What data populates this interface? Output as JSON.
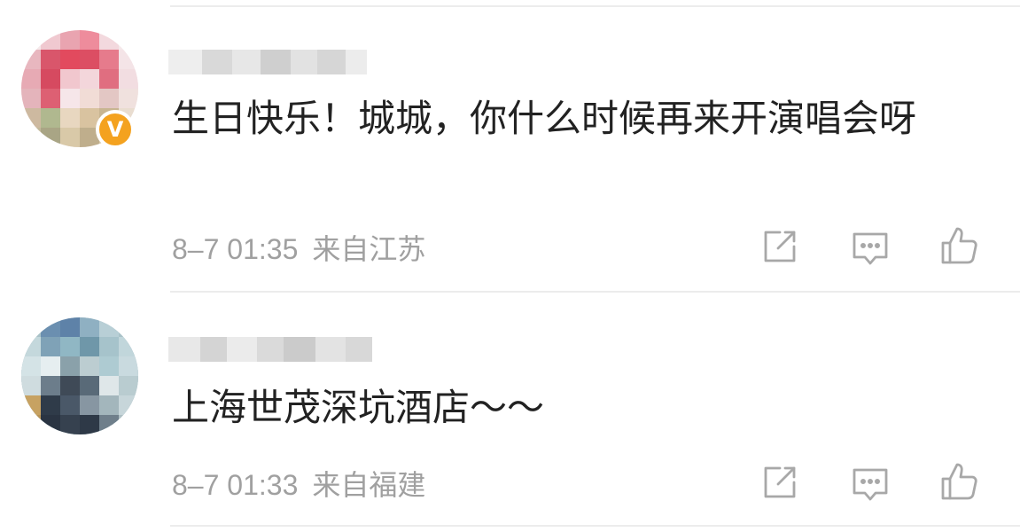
{
  "comments": [
    {
      "text": "生日快乐！城城，你什么时候再来开演唱会呀",
      "date": "8–7 01:35",
      "location": "来自江苏",
      "verified": true,
      "verified_badge": "V",
      "avatar_colors": [
        "#e8a6b1",
        "#d9566b",
        "#f2d0d8",
        "#e24a5e",
        "#b0b88f",
        "#f1e2d6"
      ]
    },
    {
      "text": "上海世茂深坑酒店～～",
      "date": "8–7 01:33",
      "location": "来自福建",
      "verified": false,
      "avatar_colors": [
        "#5e82a8",
        "#90b7c4",
        "#3f4a57",
        "#c4d8dc",
        "#2f3b49",
        "#c7a262"
      ]
    }
  ],
  "icons": {
    "share": "share-icon",
    "comment": "comment-icon",
    "like": "like-icon"
  }
}
